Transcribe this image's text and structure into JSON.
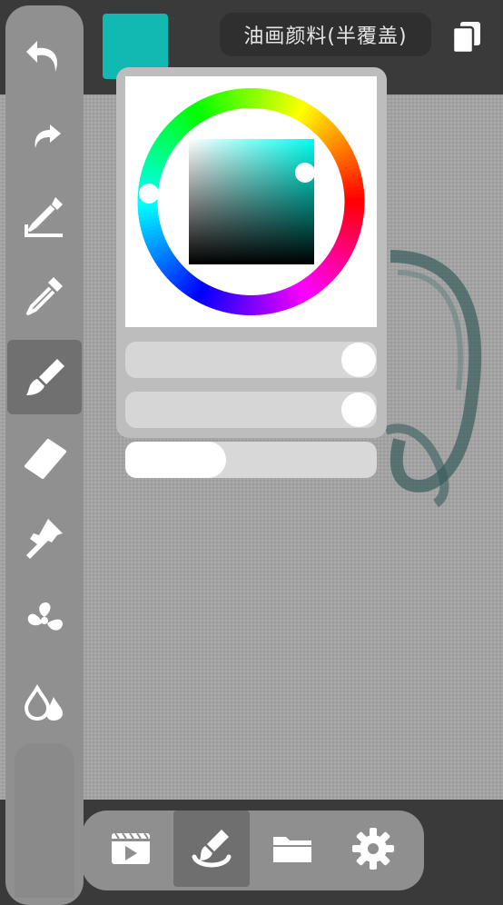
{
  "header": {
    "brush_name": "油画颜料(半覆盖)",
    "current_color": "#12b8b2"
  },
  "toolbar": {
    "items": [
      {
        "name": "undo",
        "icon": "undo-icon"
      },
      {
        "name": "redo",
        "icon": "redo-icon"
      },
      {
        "name": "fill-eyedropper",
        "icon": "fill-dropper-icon"
      },
      {
        "name": "eyedropper",
        "icon": "eyedropper-icon"
      },
      {
        "name": "brush",
        "icon": "brush-icon",
        "active": true
      },
      {
        "name": "eraser",
        "icon": "eraser-icon"
      },
      {
        "name": "smudge",
        "icon": "smudge-hand-icon"
      },
      {
        "name": "blur",
        "icon": "fan-icon"
      },
      {
        "name": "water",
        "icon": "water-drops-icon"
      }
    ]
  },
  "color_picker": {
    "hue_color": "#00ffee",
    "opacity_value": 1.0,
    "flow_value": 1.0
  },
  "brush_size": {
    "value": 0.4
  },
  "bottom_bar": {
    "tabs": [
      {
        "name": "playback",
        "icon": "video-player-icon"
      },
      {
        "name": "paint",
        "icon": "paint-brush-icon",
        "active": true
      },
      {
        "name": "files",
        "icon": "folder-icon"
      },
      {
        "name": "settings",
        "icon": "gear-icon"
      }
    ]
  }
}
